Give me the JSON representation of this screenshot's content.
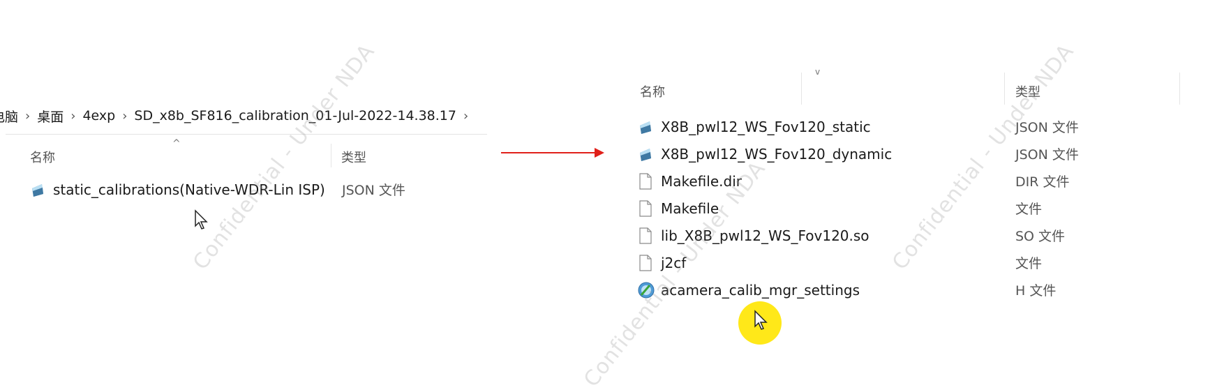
{
  "left_panel": {
    "breadcrumb": [
      "电脑",
      "桌面",
      "4exp",
      "SD_x8b_SF816_calibration_01-Jul-2022-14.38.17"
    ],
    "columns": {
      "name": "名称",
      "type": "类型"
    },
    "files": [
      {
        "name": "static_calibrations(Native-WDR-Lin ISP)",
        "type": "JSON 文件",
        "icon": "json-file-icon"
      }
    ]
  },
  "right_panel": {
    "columns": {
      "name": "名称",
      "type": "类型"
    },
    "files": [
      {
        "name": "X8B_pwl12_WS_Fov120_static",
        "type": "JSON 文件",
        "icon": "json-file-icon"
      },
      {
        "name": "X8B_pwl12_WS_Fov120_dynamic",
        "type": "JSON 文件",
        "icon": "json-file-icon"
      },
      {
        "name": "Makefile.dir",
        "type": "DIR 文件",
        "icon": "blank-file-icon"
      },
      {
        "name": "Makefile",
        "type": "文件",
        "icon": "blank-file-icon"
      },
      {
        "name": "lib_X8B_pwl12_WS_Fov120.so",
        "type": "SO 文件",
        "icon": "blank-file-icon"
      },
      {
        "name": "j2cf",
        "type": "文件",
        "icon": "blank-file-icon"
      },
      {
        "name": "acamera_calib_mgr_settings",
        "type": "H 文件",
        "icon": "c-header-file-icon"
      }
    ]
  },
  "watermark": "Confidential - Under NDA",
  "colors": {
    "arrow": "#e0201a",
    "cursor_highlight": "#ffe600"
  }
}
